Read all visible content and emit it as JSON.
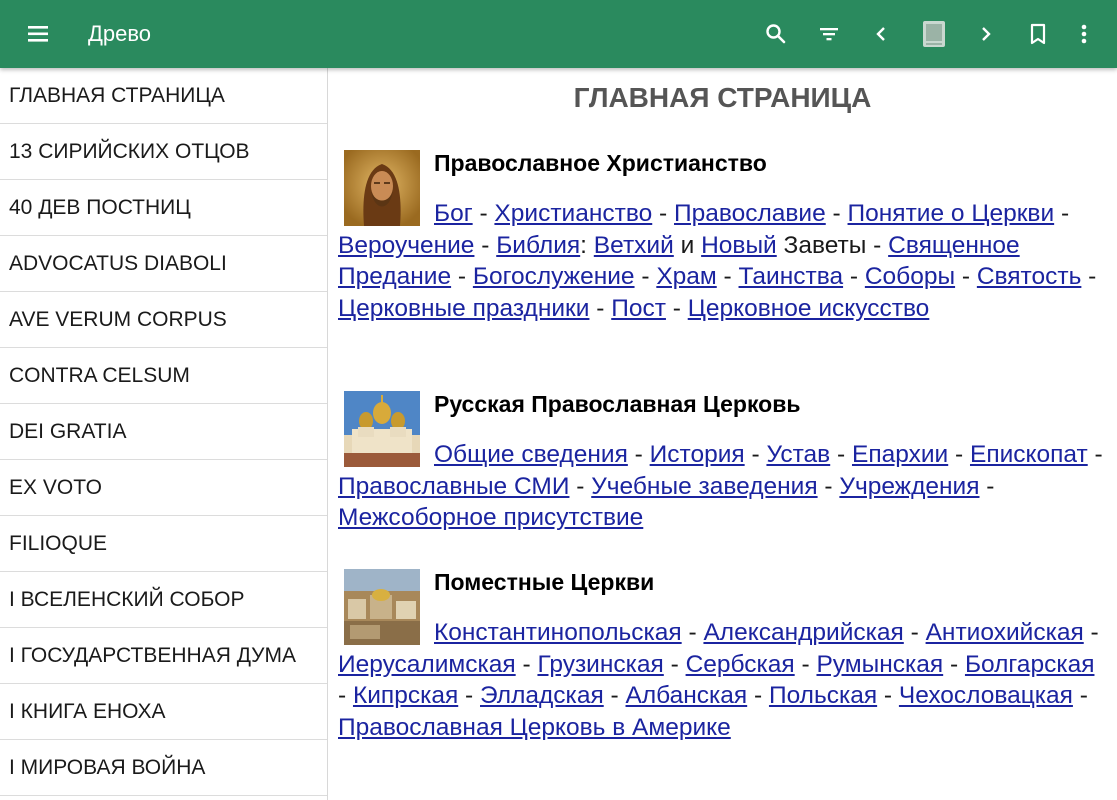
{
  "appbar": {
    "title": "Древо",
    "icons": [
      "menu-icon",
      "search-icon",
      "filter-icon",
      "chevron-left-icon",
      "book-icon",
      "chevron-right-icon",
      "bookmark-icon",
      "more-vert-icon"
    ],
    "background": "#2a8a5e"
  },
  "sidebar": {
    "items": [
      {
        "label": "ГЛАВНАЯ СТРАНИЦА"
      },
      {
        "label": "13 СИРИЙСКИХ ОТЦОВ"
      },
      {
        "label": "40 ДЕВ ПОСТНИЦ"
      },
      {
        "label": "ADVOCATUS DIABOLI"
      },
      {
        "label": "AVE VERUM CORPUS"
      },
      {
        "label": "CONTRA CELSUM"
      },
      {
        "label": "DEI GRATIA"
      },
      {
        "label": "EX VOTO"
      },
      {
        "label": "FILIOQUE"
      },
      {
        "label": "I ВСЕЛЕНСКИЙ СОБОР"
      },
      {
        "label": "I ГОСУДАРСТВЕННАЯ ДУМА"
      },
      {
        "label": "I КНИГА ЕНОХА"
      },
      {
        "label": "I МИРОВАЯ ВОЙНА"
      }
    ]
  },
  "main": {
    "page_title": "ГЛАВНАЯ СТРАНИЦА",
    "sections": [
      {
        "heading": "Православное Христианство",
        "tokens": [
          {
            "t": "link",
            "v": "Бог"
          },
          {
            "t": "text",
            "v": " - "
          },
          {
            "t": "link",
            "v": "Христианство"
          },
          {
            "t": "text",
            "v": " - "
          },
          {
            "t": "link",
            "v": "Православие"
          },
          {
            "t": "text",
            "v": " - "
          },
          {
            "t": "link",
            "v": "Понятие о Церкви"
          },
          {
            "t": "text",
            "v": " - "
          },
          {
            "t": "link",
            "v": "Вероучение"
          },
          {
            "t": "text",
            "v": " - "
          },
          {
            "t": "link",
            "v": "Библия"
          },
          {
            "t": "text",
            "v": ": "
          },
          {
            "t": "link",
            "v": "Ветхий"
          },
          {
            "t": "text",
            "v": " и "
          },
          {
            "t": "link",
            "v": "Новый"
          },
          {
            "t": "text",
            "v": " Заветы - "
          },
          {
            "t": "link",
            "v": "Священное Предание"
          },
          {
            "t": "text",
            "v": " - "
          },
          {
            "t": "link",
            "v": "Богослужение"
          },
          {
            "t": "text",
            "v": " - "
          },
          {
            "t": "link",
            "v": "Храм"
          },
          {
            "t": "text",
            "v": " - "
          },
          {
            "t": "link",
            "v": "Таинства"
          },
          {
            "t": "text",
            "v": " - "
          },
          {
            "t": "link",
            "v": "Соборы"
          },
          {
            "t": "text",
            "v": " - "
          },
          {
            "t": "link",
            "v": "Святость"
          },
          {
            "t": "text",
            "v": " - "
          },
          {
            "t": "link",
            "v": "Церковные праздники"
          },
          {
            "t": "text",
            "v": " - "
          },
          {
            "t": "link",
            "v": "Пост"
          },
          {
            "t": "text",
            "v": " - "
          },
          {
            "t": "link",
            "v": "Церковное искусство"
          }
        ]
      },
      {
        "heading": "Русская Православная Церковь",
        "tokens": [
          {
            "t": "link",
            "v": "Общие сведения"
          },
          {
            "t": "text",
            "v": " - "
          },
          {
            "t": "link",
            "v": "История"
          },
          {
            "t": "text",
            "v": " - "
          },
          {
            "t": "link",
            "v": "Устав"
          },
          {
            "t": "text",
            "v": " - "
          },
          {
            "t": "link",
            "v": "Епархии"
          },
          {
            "t": "text",
            "v": " - "
          },
          {
            "t": "link",
            "v": "Епископат"
          },
          {
            "t": "text",
            "v": " - "
          },
          {
            "t": "link",
            "v": "Православные СМИ"
          },
          {
            "t": "text",
            "v": " - "
          },
          {
            "t": "link",
            "v": "Учебные заведения"
          },
          {
            "t": "text",
            "v": " - "
          },
          {
            "t": "link",
            "v": "Учреждения"
          },
          {
            "t": "text",
            "v": " - "
          },
          {
            "t": "link",
            "v": "Межсоборное присутствие"
          }
        ]
      },
      {
        "heading": "Поместные Церкви",
        "tokens": [
          {
            "t": "link",
            "v": "Константинопольская"
          },
          {
            "t": "text",
            "v": " - "
          },
          {
            "t": "link",
            "v": "Александрийская"
          },
          {
            "t": "text",
            "v": " - "
          },
          {
            "t": "link",
            "v": "Антиохийская"
          },
          {
            "t": "text",
            "v": " - "
          },
          {
            "t": "link",
            "v": "Иерусалимская"
          },
          {
            "t": "text",
            "v": " - "
          },
          {
            "t": "link",
            "v": "Грузинская"
          },
          {
            "t": "text",
            "v": " - "
          },
          {
            "t": "link",
            "v": "Сербская"
          },
          {
            "t": "text",
            "v": " - "
          },
          {
            "t": "link",
            "v": "Румынская"
          },
          {
            "t": "text",
            "v": " - "
          },
          {
            "t": "link",
            "v": "Болгарская"
          },
          {
            "t": "text",
            "v": " - "
          },
          {
            "t": "link",
            "v": "Кипрская"
          },
          {
            "t": "text",
            "v": " - "
          },
          {
            "t": "link",
            "v": "Элладская"
          },
          {
            "t": "text",
            "v": " - "
          },
          {
            "t": "link",
            "v": "Албанская"
          },
          {
            "t": "text",
            "v": " - "
          },
          {
            "t": "link",
            "v": "Польская"
          },
          {
            "t": "text",
            "v": " - "
          },
          {
            "t": "link",
            "v": "Чехословацкая"
          },
          {
            "t": "text",
            "v": " - "
          },
          {
            "t": "link",
            "v": "Православная Церковь в Америке"
          }
        ]
      }
    ],
    "link_color": "#1b24a0"
  }
}
